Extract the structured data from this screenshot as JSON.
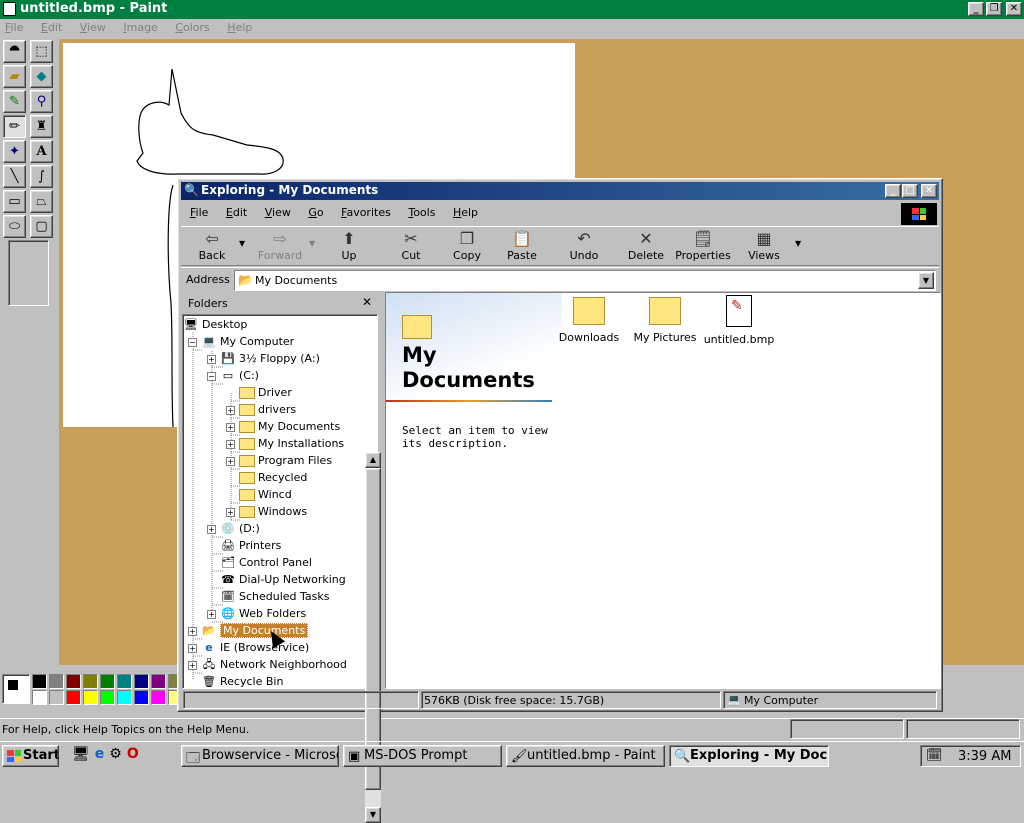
{
  "paint": {
    "title": "untitled.bmp - Paint",
    "menu": [
      "File",
      "Edit",
      "View",
      "Image",
      "Colors",
      "Help"
    ],
    "status": "For Help, click Help Topics on the Help Menu.",
    "palette": [
      "#000000",
      "#808080",
      "#800000",
      "#808000",
      "#008000",
      "#008080",
      "#000080",
      "#800080",
      "#808040",
      "#004040",
      "#ffffff",
      "#c0c0c0",
      "#ff0000",
      "#ffff00",
      "#00ff00",
      "#00ffff",
      "#0000ff",
      "#ff00ff",
      "#ffff80",
      "#00ff80"
    ]
  },
  "explorer": {
    "title": "Exploring - My Documents",
    "menu": [
      "File",
      "Edit",
      "View",
      "Go",
      "Favorites",
      "Tools",
      "Help"
    ],
    "toolbar": {
      "back": "Back",
      "forward": "Forward",
      "up": "Up",
      "cut": "Cut",
      "copy": "Copy",
      "paste": "Paste",
      "undo": "Undo",
      "delete": "Delete",
      "properties": "Properties",
      "views": "Views"
    },
    "address": {
      "label": "Address",
      "value": "My Documents"
    },
    "folders_header": "Folders",
    "tree": {
      "desktop": "Desktop",
      "my_computer": "My Computer",
      "floppy": "3½ Floppy (A:)",
      "c_drive": "(C:)",
      "c_children": [
        "Driver",
        "drivers",
        "My Documents",
        "My Installations",
        "Program Files",
        "Recycled",
        "Wincd",
        "Windows"
      ],
      "d_drive": "(D:)",
      "printers": "Printers",
      "control_panel": "Control Panel",
      "dialup": "Dial-Up Networking",
      "scheduled": "Scheduled Tasks",
      "web_folders": "Web Folders",
      "my_documents": "My Documents",
      "ie": "IE (Browservice)",
      "network": "Network Neighborhood",
      "recycle": "Recycle Bin"
    },
    "webview": {
      "title_line1": "My",
      "title_line2": "Documents",
      "description_line1": "Select an item to view",
      "description_line2": "its description."
    },
    "files": [
      "Downloads",
      "My Pictures",
      "untitled.bmp"
    ],
    "status": {
      "size": "576KB (Disk free space: 15.7GB)",
      "zone": "My Computer"
    }
  },
  "taskbar": {
    "start": "Start",
    "tasks": [
      "Browservice - Microsof...",
      "MS-DOS Prompt",
      "untitled.bmp - Paint",
      "Exploring - My Docu..."
    ],
    "time": "3:39 AM"
  }
}
